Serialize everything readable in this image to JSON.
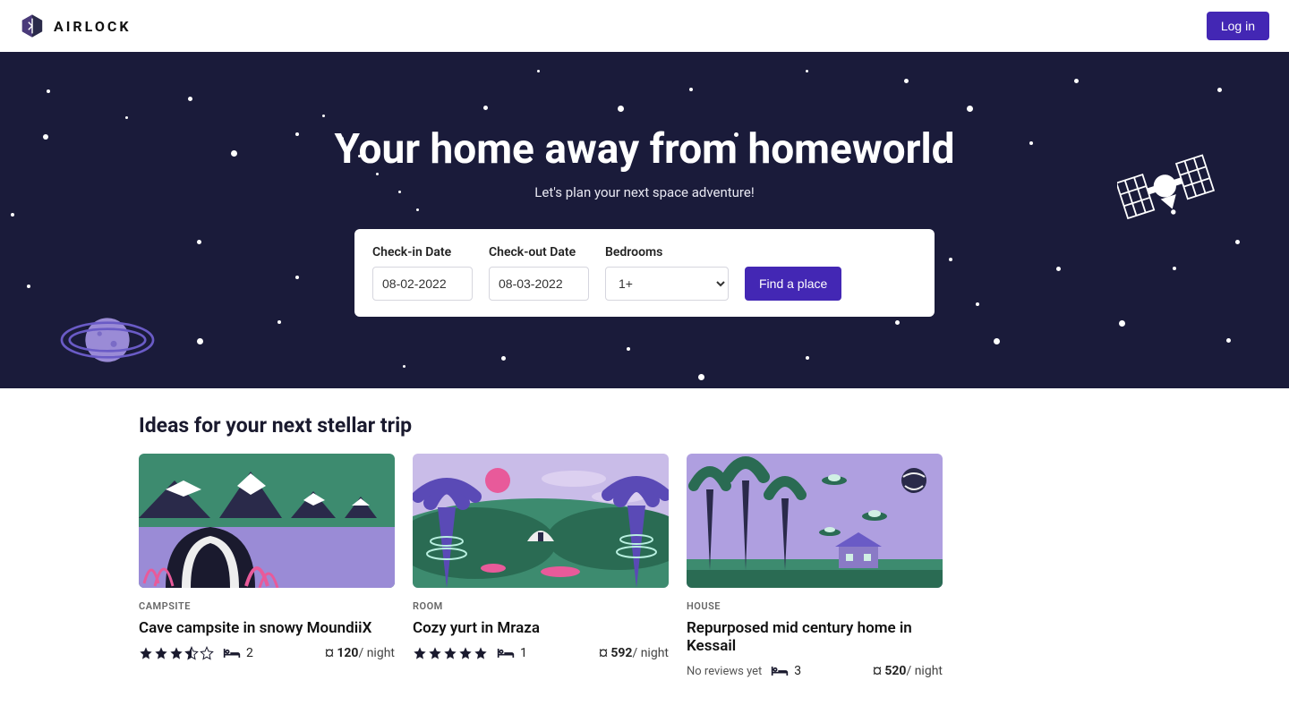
{
  "brand": {
    "name": "AIRLOCK"
  },
  "header": {
    "login_label": "Log in"
  },
  "hero": {
    "title": "Your home away from homeworld",
    "subtitle": "Let's plan your next space adventure!",
    "search": {
      "checkin_label": "Check-in Date",
      "checkin_value": "08-02-2022",
      "checkout_label": "Check-out Date",
      "checkout_value": "08-03-2022",
      "bedrooms_label": "Bedrooms",
      "bedrooms_value": "1+",
      "submit_label": "Find a place"
    }
  },
  "listings": {
    "section_title": "Ideas for your next stellar trip",
    "items": [
      {
        "type_label": "CAMPSITE",
        "title": "Cave campsite in snowy MoundiiX",
        "rating": 3.5,
        "beds": "2",
        "price": "¤ 120",
        "price_suffix": "/ night"
      },
      {
        "type_label": "ROOM",
        "title": "Cozy yurt in Mraza",
        "rating": 5,
        "beds": "1",
        "price": "¤ 592",
        "price_suffix": "/ night"
      },
      {
        "type_label": "HOUSE",
        "title": "Repurposed mid century home in Kessail",
        "no_reviews_label": "No reviews yet",
        "beds": "3",
        "price": "¤ 520",
        "price_suffix": "/ night"
      }
    ]
  },
  "colors": {
    "accent": "#4327b4",
    "hero_bg": "#1a1b3a",
    "lavender": "#9a8bd6",
    "green": "#3d8b6f",
    "dark_green": "#2a6b53",
    "pink": "#e85a9a",
    "sky": "#c9bce8"
  }
}
